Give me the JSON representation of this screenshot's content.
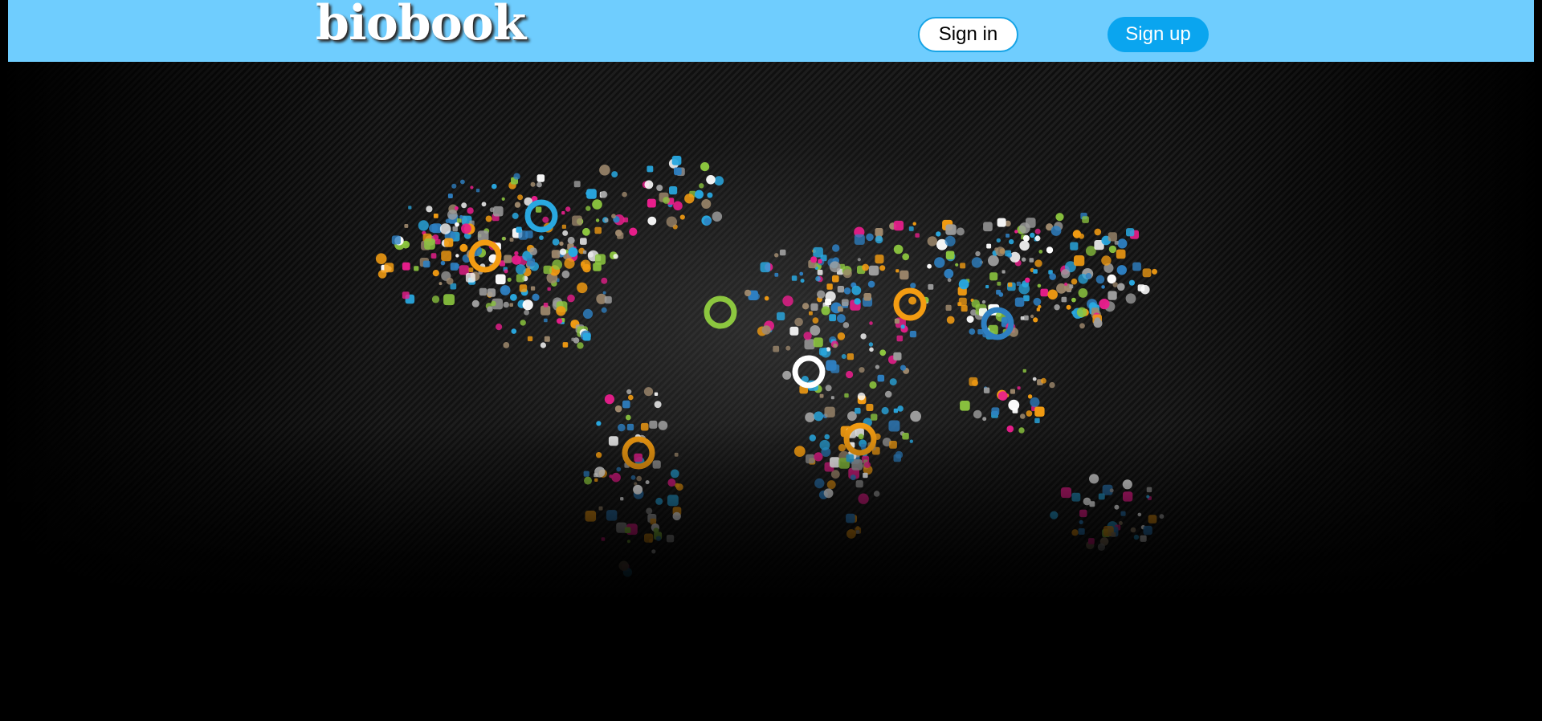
{
  "header": {
    "logo_text": "biobook",
    "signin_label": "Sign in",
    "signup_label": "Sign up",
    "background_color": "#6fcdfe",
    "signup_color": "#0aa5ef",
    "signin_border_color": "#17a4e6"
  },
  "hero": {
    "image": "world-map-made-of-colorful-icons",
    "background_color": "#000000",
    "icon_palette": [
      "#f39c12",
      "#e91e8c",
      "#29a8e0",
      "#8cc63f",
      "#9e9e9e",
      "#a08a6e",
      "#2e7fc1",
      "#ffffff"
    ]
  }
}
